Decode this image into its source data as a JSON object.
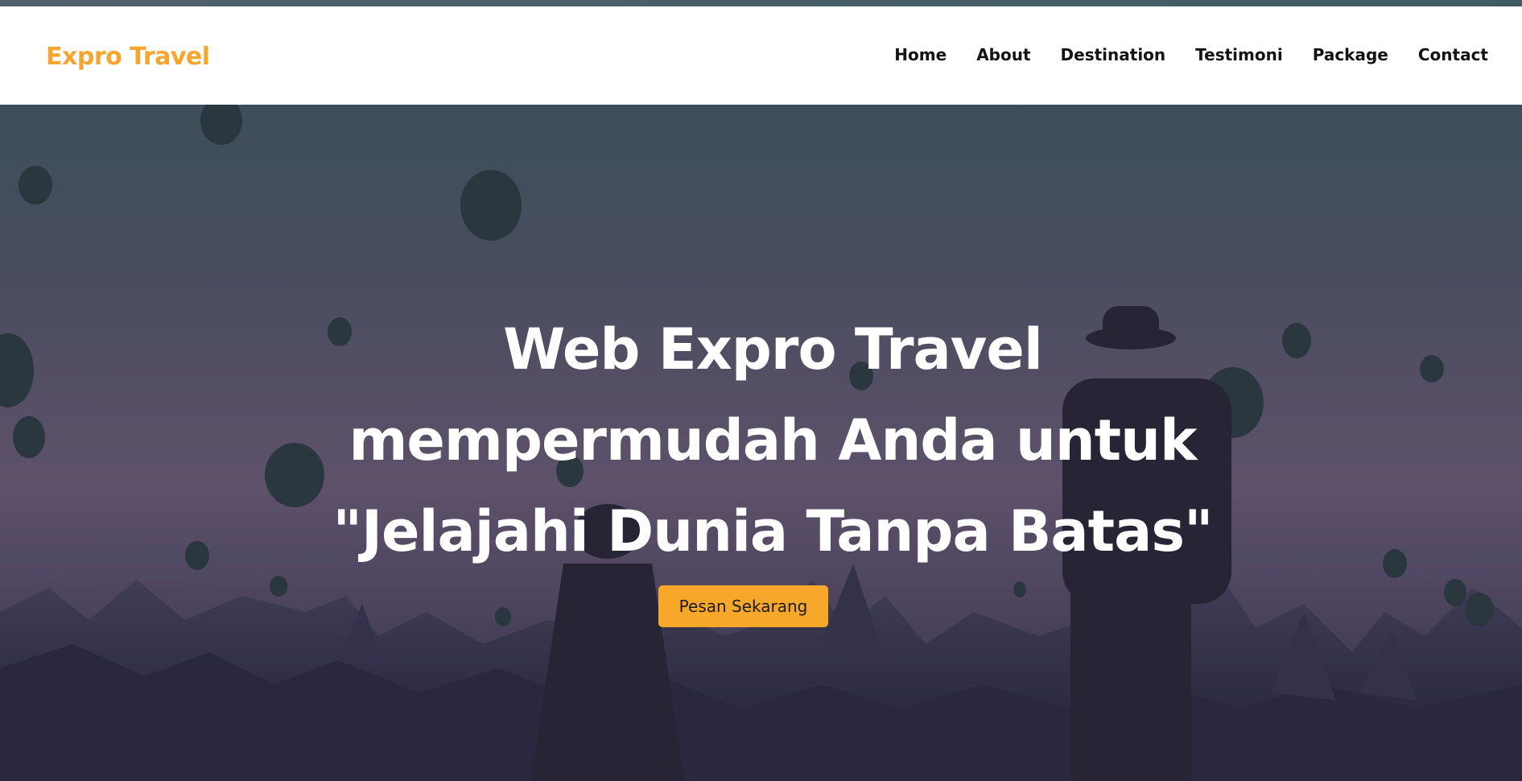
{
  "brand": {
    "name": "Expro Travel",
    "color": "#f6a630"
  },
  "nav": {
    "items": [
      {
        "label": "Home"
      },
      {
        "label": "About"
      },
      {
        "label": "Destination"
      },
      {
        "label": "Testimoni"
      },
      {
        "label": "Package"
      },
      {
        "label": "Contact"
      }
    ]
  },
  "hero": {
    "title_lines": [
      "Web Expro Travel",
      "mempermudah Anda untuk",
      "\"Jelajahi Dunia Tanpa Batas\""
    ],
    "cta_label": "Pesan Sekarang",
    "cta_color": "#f7a72a",
    "background": "hot-air-balloons-photo"
  }
}
